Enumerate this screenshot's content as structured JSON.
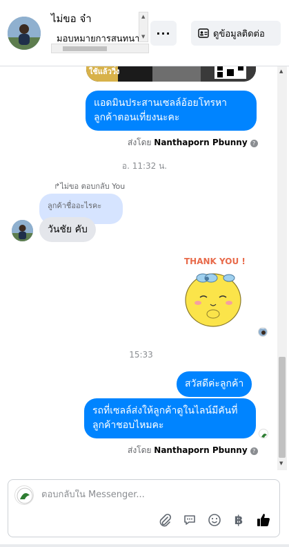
{
  "header": {
    "contact_name": "ไม่ขอ จ๋า",
    "subtitle": "มอบหมายการสนทนา",
    "more_label": "···",
    "contact_info_label": "ดูข้อมูลติดต่อ"
  },
  "messages": {
    "out_1": "แอดมินประสานเซลล์อ้อยโทรหาลูกค้าตอนเที่ยงนะคะ",
    "sent_by_prefix_1": "ส่งโดย",
    "sent_by_name_1": "Nanthaporn Pbunny",
    "timestamp_1": "อ. 11:32 น.",
    "reply_note": "ไม่ขอ ตอบกลับ You",
    "quoted_text": "ลูกค้าชื่ออะไรคะ",
    "in_1": "วันชัย คับ",
    "sticker_text": "THANK YOU !",
    "timestamp_2": "15:33",
    "out_2": "สวัสดีค่ะลูกค้า",
    "out_3": "รถที่เซลล์ส่งให้ลูกค้าดูในไลน์มีคันที่ลูกค้าชอบไหมคะ",
    "sent_by_prefix_2": "ส่งโดย",
    "sent_by_name_2": "Nanthaporn Pbunny",
    "image_text": "ใช้แล้ววิ่ง"
  },
  "composer": {
    "placeholder": "ตอบกลับใน Messenger..."
  },
  "colors": {
    "outgoing_bubble": "#0084ff",
    "incoming_bubble": "#e4e6eb",
    "quoted_bubble": "#d6e4ff"
  },
  "icons": [
    "attachment-icon",
    "saved-reply-icon",
    "emoji-icon",
    "baht-icon",
    "like-icon",
    "info-icon",
    "contact-card-icon"
  ]
}
